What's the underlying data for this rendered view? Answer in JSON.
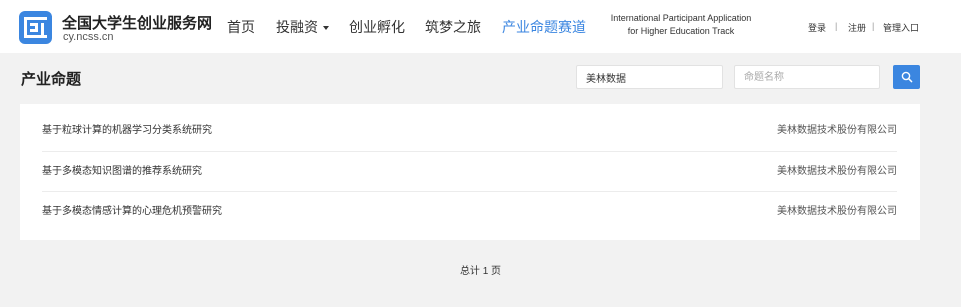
{
  "brand": {
    "title": "全国大学生创业服务网",
    "subtitle": "cy.ncss.cn",
    "logo_icon": "cy-logo-icon",
    "color": "#3b86e0"
  },
  "nav": {
    "items": [
      {
        "label": "首页"
      },
      {
        "label": "投融资"
      },
      {
        "label": "创业孵化"
      },
      {
        "label": "筑梦之旅"
      },
      {
        "label": "产业命题赛道",
        "active": true
      }
    ],
    "intl_line1": "International Participant Application",
    "intl_line2": "for Higher Education Track"
  },
  "auth": {
    "login": "登录",
    "register": "注册",
    "admin": "管理入口",
    "separator": "|"
  },
  "page": {
    "title": "产业命题"
  },
  "search": {
    "company_value": "美林数据",
    "topic_placeholder": "命题名称",
    "button_icon": "search-icon"
  },
  "rows": [
    {
      "topic": "基于粒球计算的机器学习分类系统研究",
      "company": "美林数据技术股份有限公司"
    },
    {
      "topic": "基于多模态知识图谱的推荐系统研究",
      "company": "美林数据技术股份有限公司"
    },
    {
      "topic": "基于多模态情感计算的心理危机预警研究",
      "company": "美林数据技术股份有限公司"
    }
  ],
  "pager": {
    "text": "总计 1 页"
  }
}
